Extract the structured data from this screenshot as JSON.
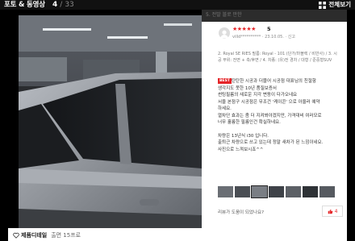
{
  "header": {
    "title": "포토 & 동영상",
    "current": "4",
    "total": "33",
    "view_all": "전체보기",
    "peek_text": "5. 전발 블로 만한"
  },
  "review": {
    "stars": "★★★★★",
    "rating": "5",
    "user": "villd**********",
    "date": "23.10.05.",
    "report": "신고",
    "options": "2. Royal SE RIES 필름: Royal - 101 (단가/마블렉 / 비반사) / 3. 시공 부위: 전면 + 측/후면 / 4. 차종: (유)전 경차 / 대형 / 준중형SUV",
    "badge": "BEST",
    "lines": [
      "탄탄한 시공과 더블어 시공점 대표님의 친절함",
      "생각지도 못한 10년 품질보증서",
      "썬팅필름의 새로운 지각 변동이 다가오네요",
      "서울 본점구 시공점은 무조건 '케이콘' 으로 아울러 예약",
      "하세요.",
      "열차단 효과는 좀 더 지켜봐야겠지만, 가격대비 여러모로",
      "너무 훌륭한 필름인건 확실하네요.",
      "차량은 13년식 i30 입니다.",
      "출퇴근 차량으로 쓰고 있는데 정말 새차가 된 느낌이네요.",
      "사진으로 느껴보시죠^^"
    ],
    "useful_question": "리뷰가 도움이 되었나요?",
    "likes": "4"
  },
  "footer": {
    "product_label": "제품디테일",
    "product_sub": "출면 15프로"
  }
}
